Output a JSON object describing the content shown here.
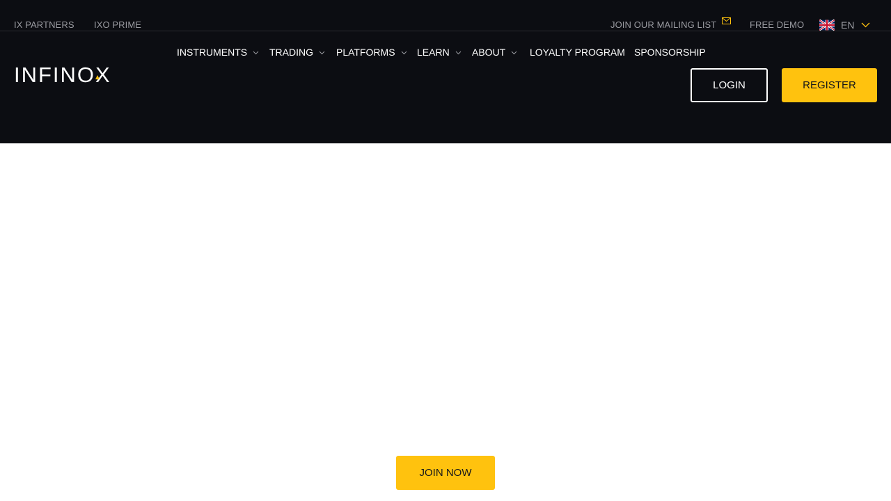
{
  "topbar": {
    "left_links": [
      "IX PARTNERS",
      "IXO PRIME"
    ],
    "mailing_list_label": "JOIN OUR MAILING LIST",
    "free_demo_label": "FREE DEMO",
    "language": "EN"
  },
  "logo": {
    "text": "INFINOX"
  },
  "nav": {
    "items": [
      {
        "label": "INSTRUMENTS",
        "has_dropdown": true
      },
      {
        "label": "TRADING",
        "has_dropdown": true
      },
      {
        "label": "PLATFORMS",
        "has_dropdown": true
      },
      {
        "label": "LEARN",
        "has_dropdown": true
      },
      {
        "label": "ABOUT",
        "has_dropdown": true
      },
      {
        "label": "LOYALTY PROGRAM",
        "has_dropdown": false
      },
      {
        "label": "SPONSORSHIP",
        "has_dropdown": false
      }
    ]
  },
  "auth": {
    "login_label": "LOGIN",
    "register_label": "REGISTER"
  },
  "main": {
    "join_label": "JOIN NOW"
  },
  "colors": {
    "header_bg": "#0c0d12",
    "accent": "#ffc20e",
    "muted_text": "#9a9ba1"
  },
  "icons": [
    "mail-icon",
    "uk-flag-icon",
    "chevron-down-icon"
  ]
}
